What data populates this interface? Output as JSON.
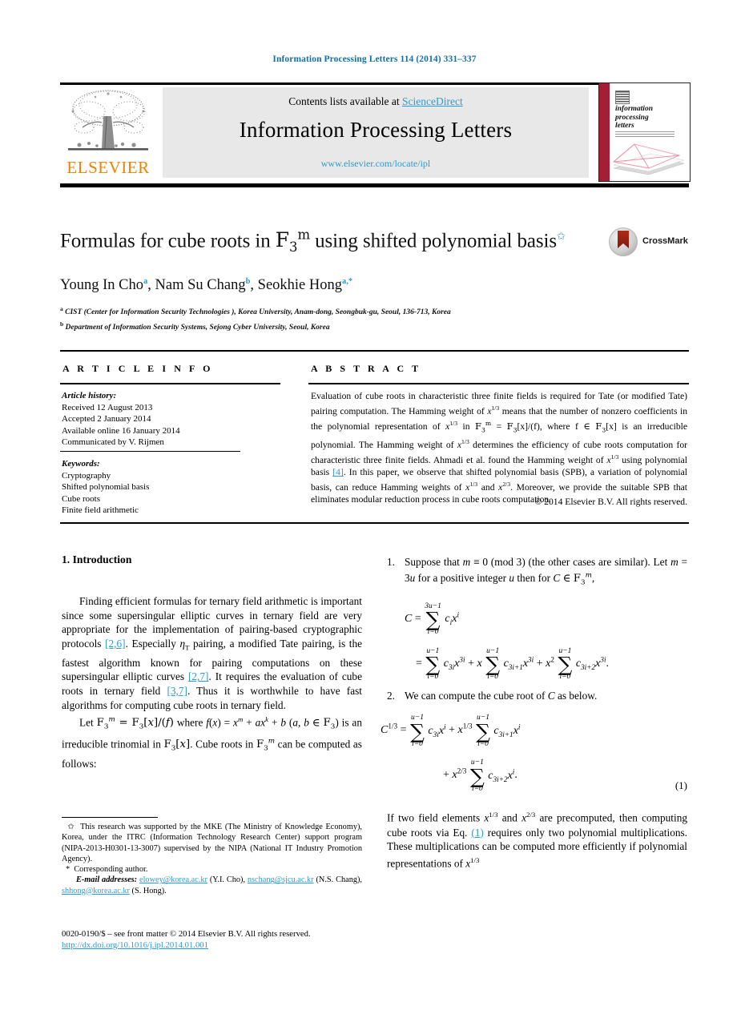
{
  "running_head": "Information Processing Letters 114 (2014) 331–337",
  "masthead": {
    "contents_prefix": "Contents lists available at ",
    "sciencedirect": "ScienceDirect",
    "journal_title": "Information Processing Letters",
    "journal_url": "www.elsevier.com/locate/ipl",
    "publisher_wordmark": "ELSEVIER",
    "cover_title_line1": "information",
    "cover_title_line2": "processing",
    "cover_title_line3": "letters"
  },
  "title_block": {
    "title_part1": "Formulas for cube roots in ",
    "title_field": "F",
    "title_field_sub": "3",
    "title_field_sup": "m",
    "title_part2": " using shifted polynomial basis",
    "title_footnote_mark": "✩",
    "authors": [
      {
        "name": "Young In Cho",
        "sup": "a"
      },
      {
        "name": "Nam Su Chang",
        "sup": "b"
      },
      {
        "name": "Seokhie Hong",
        "sup": "a,*"
      }
    ],
    "affiliations": [
      {
        "mark": "a",
        "text": "CIST (Center for Information Security Technologies ), Korea University, Anam-dong, Seongbuk-gu, Seoul, 136-713, Korea"
      },
      {
        "mark": "b",
        "text": "Department of Information Security Systems, Sejong Cyber University, Seoul, Korea"
      }
    ],
    "crossmark_label": "CrossMark"
  },
  "article_info": {
    "heading": "A R T I C L E    I N F O",
    "history_label": "Article history:",
    "history": [
      "Received 12 August 2013",
      "Accepted 2 January 2014",
      "Available online 16 January 2014",
      "Communicated by V. Rijmen"
    ],
    "keywords_label": "Keywords:",
    "keywords": [
      "Cryptography",
      "Shifted polynomial basis",
      "Cube roots",
      "Finite field arithmetic"
    ]
  },
  "abstract": {
    "heading": "A B S T R A C T",
    "text_1": "Evaluation of cube roots in characteristic three finite fields is required for Tate (or modified Tate) pairing computation. The Hamming weight of ",
    "math_1": "x",
    "math_1_sup": "1/3",
    "text_2": " means that the number of nonzero coefficients in the polynomial representation of ",
    "math_2": "x",
    "math_2_sup": "1/3",
    "text_3": " in ",
    "field_1": "F",
    "field_1_sub": "3",
    "field_1_sup": "m",
    "text_4": " = ",
    "field_2": "F",
    "field_2_sub": "3",
    "text_5": "[x]/(f), where f ∈ ",
    "field_3": "F",
    "field_3_sub": "3",
    "text_6": "[x] is an irreducible polynomial. The Hamming weight of ",
    "math_3": "x",
    "math_3_sup": "1/3",
    "text_7": " determines the efficiency of cube roots computation for characteristic three finite fields. Ahmadi et al. found the Hamming weight of ",
    "math_4": "x",
    "math_4_sup": "1/3",
    "text_8": " using polynomial basis ",
    "ref_4": "[4]",
    "text_9": ". In this paper, we observe that shifted polynomial basis (SPB), a variation of polynomial basis, can reduce Hamming weights of ",
    "math_5": "x",
    "math_5_sup": "1/3",
    "text_10": " and ",
    "math_6": "x",
    "math_6_sup": "2/3",
    "text_11": ". Moreover, we provide the suitable SPB that eliminates modular reduction process in cube roots computation.",
    "copyright": "© 2014 Elsevier B.V. All rights reserved."
  },
  "body": {
    "section_number": "1.",
    "section_title": "Introduction",
    "para_1_a": "Finding efficient formulas for ternary field arithmetic is important since some supersingular elliptic curves in ternary field are very appropriate for the implementation of pairing-based cryptographic protocols ",
    "ref_26": "[2,6]",
    "para_1_b": ". Especially ",
    "eta_t": "η",
    "eta_t_sub": "T",
    "para_1_c": " pairing, a modified Tate pairing, is the fastest algorithm known for pairing computations on these supersingular elliptic curves ",
    "ref_27": "[2,7]",
    "para_1_d": ". It requires the evaluation of cube roots in ternary field ",
    "ref_37": "[3,7]",
    "para_1_e": ". Thus it is worthwhile to have fast algorithms for computing cube roots in ternary field.",
    "para_2_a": "Let ",
    "para_2_math": "F3m = F3[x]/(f) where f(x) = xm + axk + b (a, b ∈ F3)",
    "para_2_b": " is an irreducible trinomial in ",
    "para_2_c": "F3[x]",
    "para_2_d": ". Cube roots in ",
    "para_2_e": "F3m",
    "para_2_f": " can be computed as follows:",
    "list_item_1": "Suppose that m ≡ 0 (mod 3) (the other cases are similar). Let m = 3u for a positive integer u then for C ∈ F3m,",
    "list_item_1_num": "1.",
    "list_item_2": "We can compute the cube root of C as below.",
    "list_item_2_num": "2.",
    "eq1_number": "(1)",
    "para_3_a": "If two field elements ",
    "para_3_x13": "x",
    "para_3_x13_sup": "1/3",
    "para_3_b": " and ",
    "para_3_x23": "x",
    "para_3_x23_sup": "2/3",
    "para_3_c": " are precomputed, then computing cube roots via Eq. ",
    "ref_eq1": "(1)",
    "para_3_d": " requires only two polynomial multiplications. These multiplications can be computed more efficiently if polynomial representations of ",
    "para_3_x13b": "x",
    "para_3_x13b_sup": "1/3"
  },
  "footnotes": {
    "fn1_mark": "✩",
    "fn1_text": "This research was supported by the MKE (The Ministry of Knowledge Economy), Korea, under the ITRC (Information Technology Research Center) support program (NIPA-2013-H0301-13-3007) supervised by the NIPA (National IT Industry Promotion Agency).",
    "fn2_mark": "*",
    "fn2_text": "Corresponding author.",
    "email_label": "E-mail addresses:",
    "email_1": "elowey@korea.ac.kr",
    "email_1_owner": "(Y.I. Cho)",
    "email_2": "nschang@sjcu.ac.kr",
    "email_2_owner": "(N.S. Chang)",
    "email_3": "shhong@korea.ac.kr",
    "email_3_owner": "(S. Hong)."
  },
  "issn": {
    "line1": "0020-0190/$ – see front matter © 2014 Elsevier B.V. All rights reserved.",
    "doi": "http://dx.doi.org/10.1016/j.ipl.2014.01.001"
  },
  "colors": {
    "link": "#2e9ad0",
    "running_head": "#136fa6",
    "elsevier_orange": "#ef8200",
    "band_gray": "#e8e8e8",
    "cover_red": "#a41f35"
  }
}
